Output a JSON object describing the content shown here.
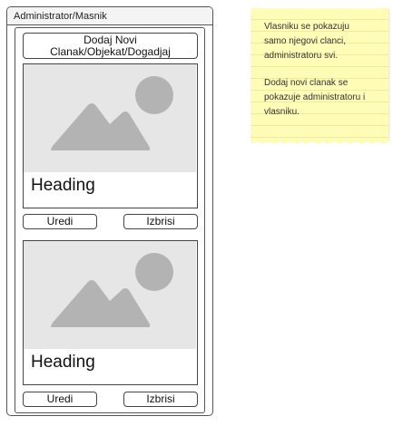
{
  "window": {
    "title": "Administrator/Masnik"
  },
  "add_button": {
    "line1": "Dodaj Novi",
    "line2": "Clanak/Objekat/Dogadjaj"
  },
  "cards": [
    {
      "heading": "Heading",
      "edit_label": "Uredi",
      "delete_label": "Izbrisi",
      "image_icon": "image-placeholder-icon"
    },
    {
      "heading": "Heading",
      "edit_label": "Uredi",
      "delete_label": "Izbrisi",
      "image_icon": "image-placeholder-icon"
    }
  ],
  "note": {
    "p1": [
      "Vlasniku se pokazuju",
      "samo njegovi clanci,",
      "administratoru svi."
    ],
    "p2": [
      "Dodaj novi clanak se",
      "pokazuje administratoru i",
      "vlasniku."
    ]
  },
  "colors": {
    "note_bg": "#fffcb8",
    "image_bg": "#e6e6e6",
    "image_shape": "#b3b3b3"
  }
}
